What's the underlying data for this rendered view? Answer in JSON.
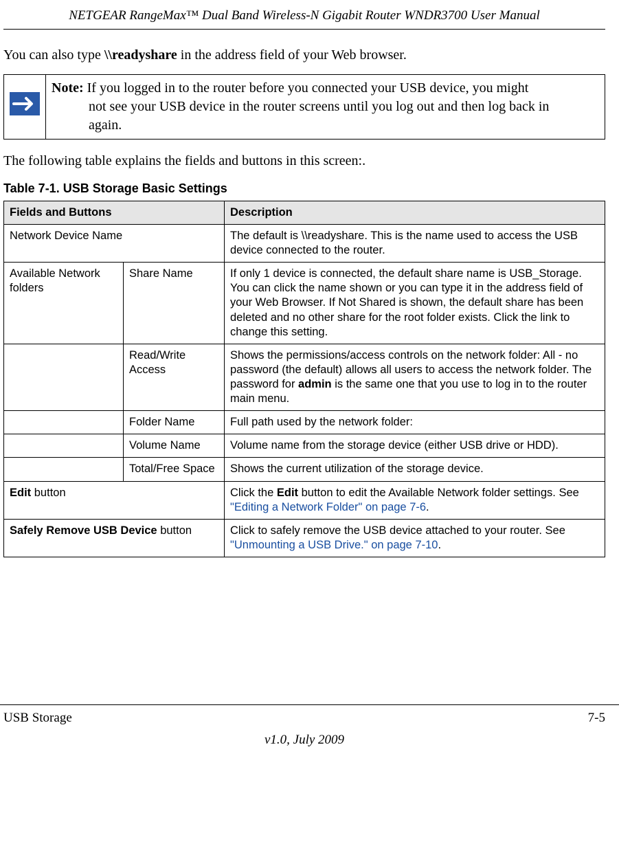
{
  "header": {
    "title": "NETGEAR RangeMax™ Dual Band Wireless-N Gigabit Router WNDR3700 User Manual"
  },
  "paragraphs": {
    "intro_before": "You can also type ",
    "intro_bold": "\\\\readyshare",
    "intro_after": " in the address field of your Web browser.",
    "table_lead": "The following table explains the fields and buttons in this screen:."
  },
  "note": {
    "label": "Note:",
    "line1": " If you logged in to the router before you connected your USB device, you might",
    "line2": "not see your USB device in the router screens until you log out and then log back in",
    "line3": "again."
  },
  "table_caption_prefix": "Table 7-1.   ",
  "table_caption_title": "USB Storage Basic Settings",
  "table_headers": {
    "col1": "Fields and Buttons",
    "col2": "Description"
  },
  "rows": {
    "r1_c1": "Network Device Name",
    "r1_c3": "The default is \\\\readyshare. This is the name used to access the USB device connected to the router.",
    "r2_c1": "Available Network folders",
    "r2_c2": "Share Name",
    "r2_c3": "If only 1 device is connected, the default share name is USB_Storage. You can click the name shown or you can type it in the address field of your Web Browser. If Not Shared is shown, the default share has been deleted and no other share for the root folder exists. Click the link to change this setting.",
    "r3_c2": "Read/Write Access",
    "r3_c3_a": "Shows the permissions/access controls on the network folder: All - no password (the default) allows all users to access the network folder. The password for ",
    "r3_c3_bold": "admin",
    "r3_c3_b": " is the same one that you use to log in to the router main menu.",
    "r4_c2": "Folder Name",
    "r4_c3": "Full path used by the network folder:",
    "r5_c2": "Volume Name",
    "r5_c3": "Volume name from the storage device (either USB drive or HDD).",
    "r6_c2": "Total/Free Space",
    "r6_c3": "Shows the current utilization of the storage device.",
    "r7_c1_bold": "Edit",
    "r7_c1_after": " button",
    "r7_c3_a": "Click the ",
    "r7_c3_bold": "Edit",
    "r7_c3_b": " button to edit the Available Network folder settings. See ",
    "r7_c3_link": "\"Editing a Network Folder\" on page 7-6",
    "r7_c3_c": ".",
    "r8_c1_bold": "Safely Remove USB Device",
    "r8_c1_after": " button",
    "r8_c3_a": "Click to safely remove the USB device attached to your router. See ",
    "r8_c3_link": "\"Unmounting a USB Drive.\" on page 7-10",
    "r8_c3_b": "."
  },
  "footer": {
    "section": "USB Storage",
    "page": "7-5",
    "version": "v1.0, July 2009"
  }
}
